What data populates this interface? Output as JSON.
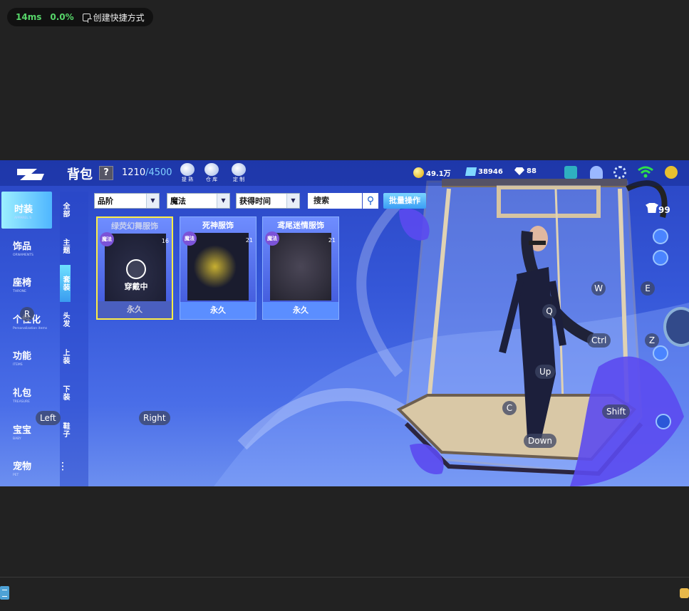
{
  "overlay": {
    "latency": "14ms",
    "loss": "0.0%",
    "shortcut_label": "创建快捷方式"
  },
  "header": {
    "title": "背包",
    "help": "?",
    "capacity_used": "1210",
    "capacity_max": "/4500",
    "tools": [
      {
        "label": "提 熟"
      },
      {
        "label": "仓 库"
      },
      {
        "label": "定 制"
      }
    ],
    "resources": {
      "coins": "49.1万",
      "gems": "38946",
      "diamonds": "88"
    }
  },
  "nav": [
    {
      "cn": "时装",
      "en": "APPAREL S",
      "active": true
    },
    {
      "cn": "饰品",
      "en": "ORNAMENTS"
    },
    {
      "cn": "座椅",
      "en": "THRONE"
    },
    {
      "cn": "个性化",
      "en": "Personalization items"
    },
    {
      "cn": "功能",
      "en": "ITEMS"
    },
    {
      "cn": "礼包",
      "en": "TREASURE"
    },
    {
      "cn": "宝宝",
      "en": "BABY"
    },
    {
      "cn": "宠物",
      "en": "PET"
    }
  ],
  "subnav": [
    "全部",
    "主题",
    "套装",
    "头发",
    "上装",
    "下装",
    "鞋子",
    "..."
  ],
  "filters": {
    "quality": "品阶",
    "magic": "魔法",
    "time": "获得时间",
    "search": "搜索",
    "batch": "批量操作"
  },
  "items": [
    {
      "name": "绿荧幻舞服饰",
      "badge": "魔法",
      "count": "16",
      "duration": "永久",
      "wearing": "穿戴中"
    },
    {
      "name": "死神服饰",
      "badge": "魔法",
      "count": "21",
      "duration": "永久"
    },
    {
      "name": "鸢尾迷情服饰",
      "badge": "魔法",
      "count": "21",
      "duration": "永久"
    }
  ],
  "right_count": "99",
  "keys": {
    "R": "R",
    "Left": "Left",
    "Right": "Right",
    "W": "W",
    "E": "E",
    "Q": "Q",
    "Ctrl": "Ctrl",
    "Z": "Z",
    "Up": "Up",
    "C": "C",
    "Shift": "Shift",
    "Down": "Down"
  }
}
